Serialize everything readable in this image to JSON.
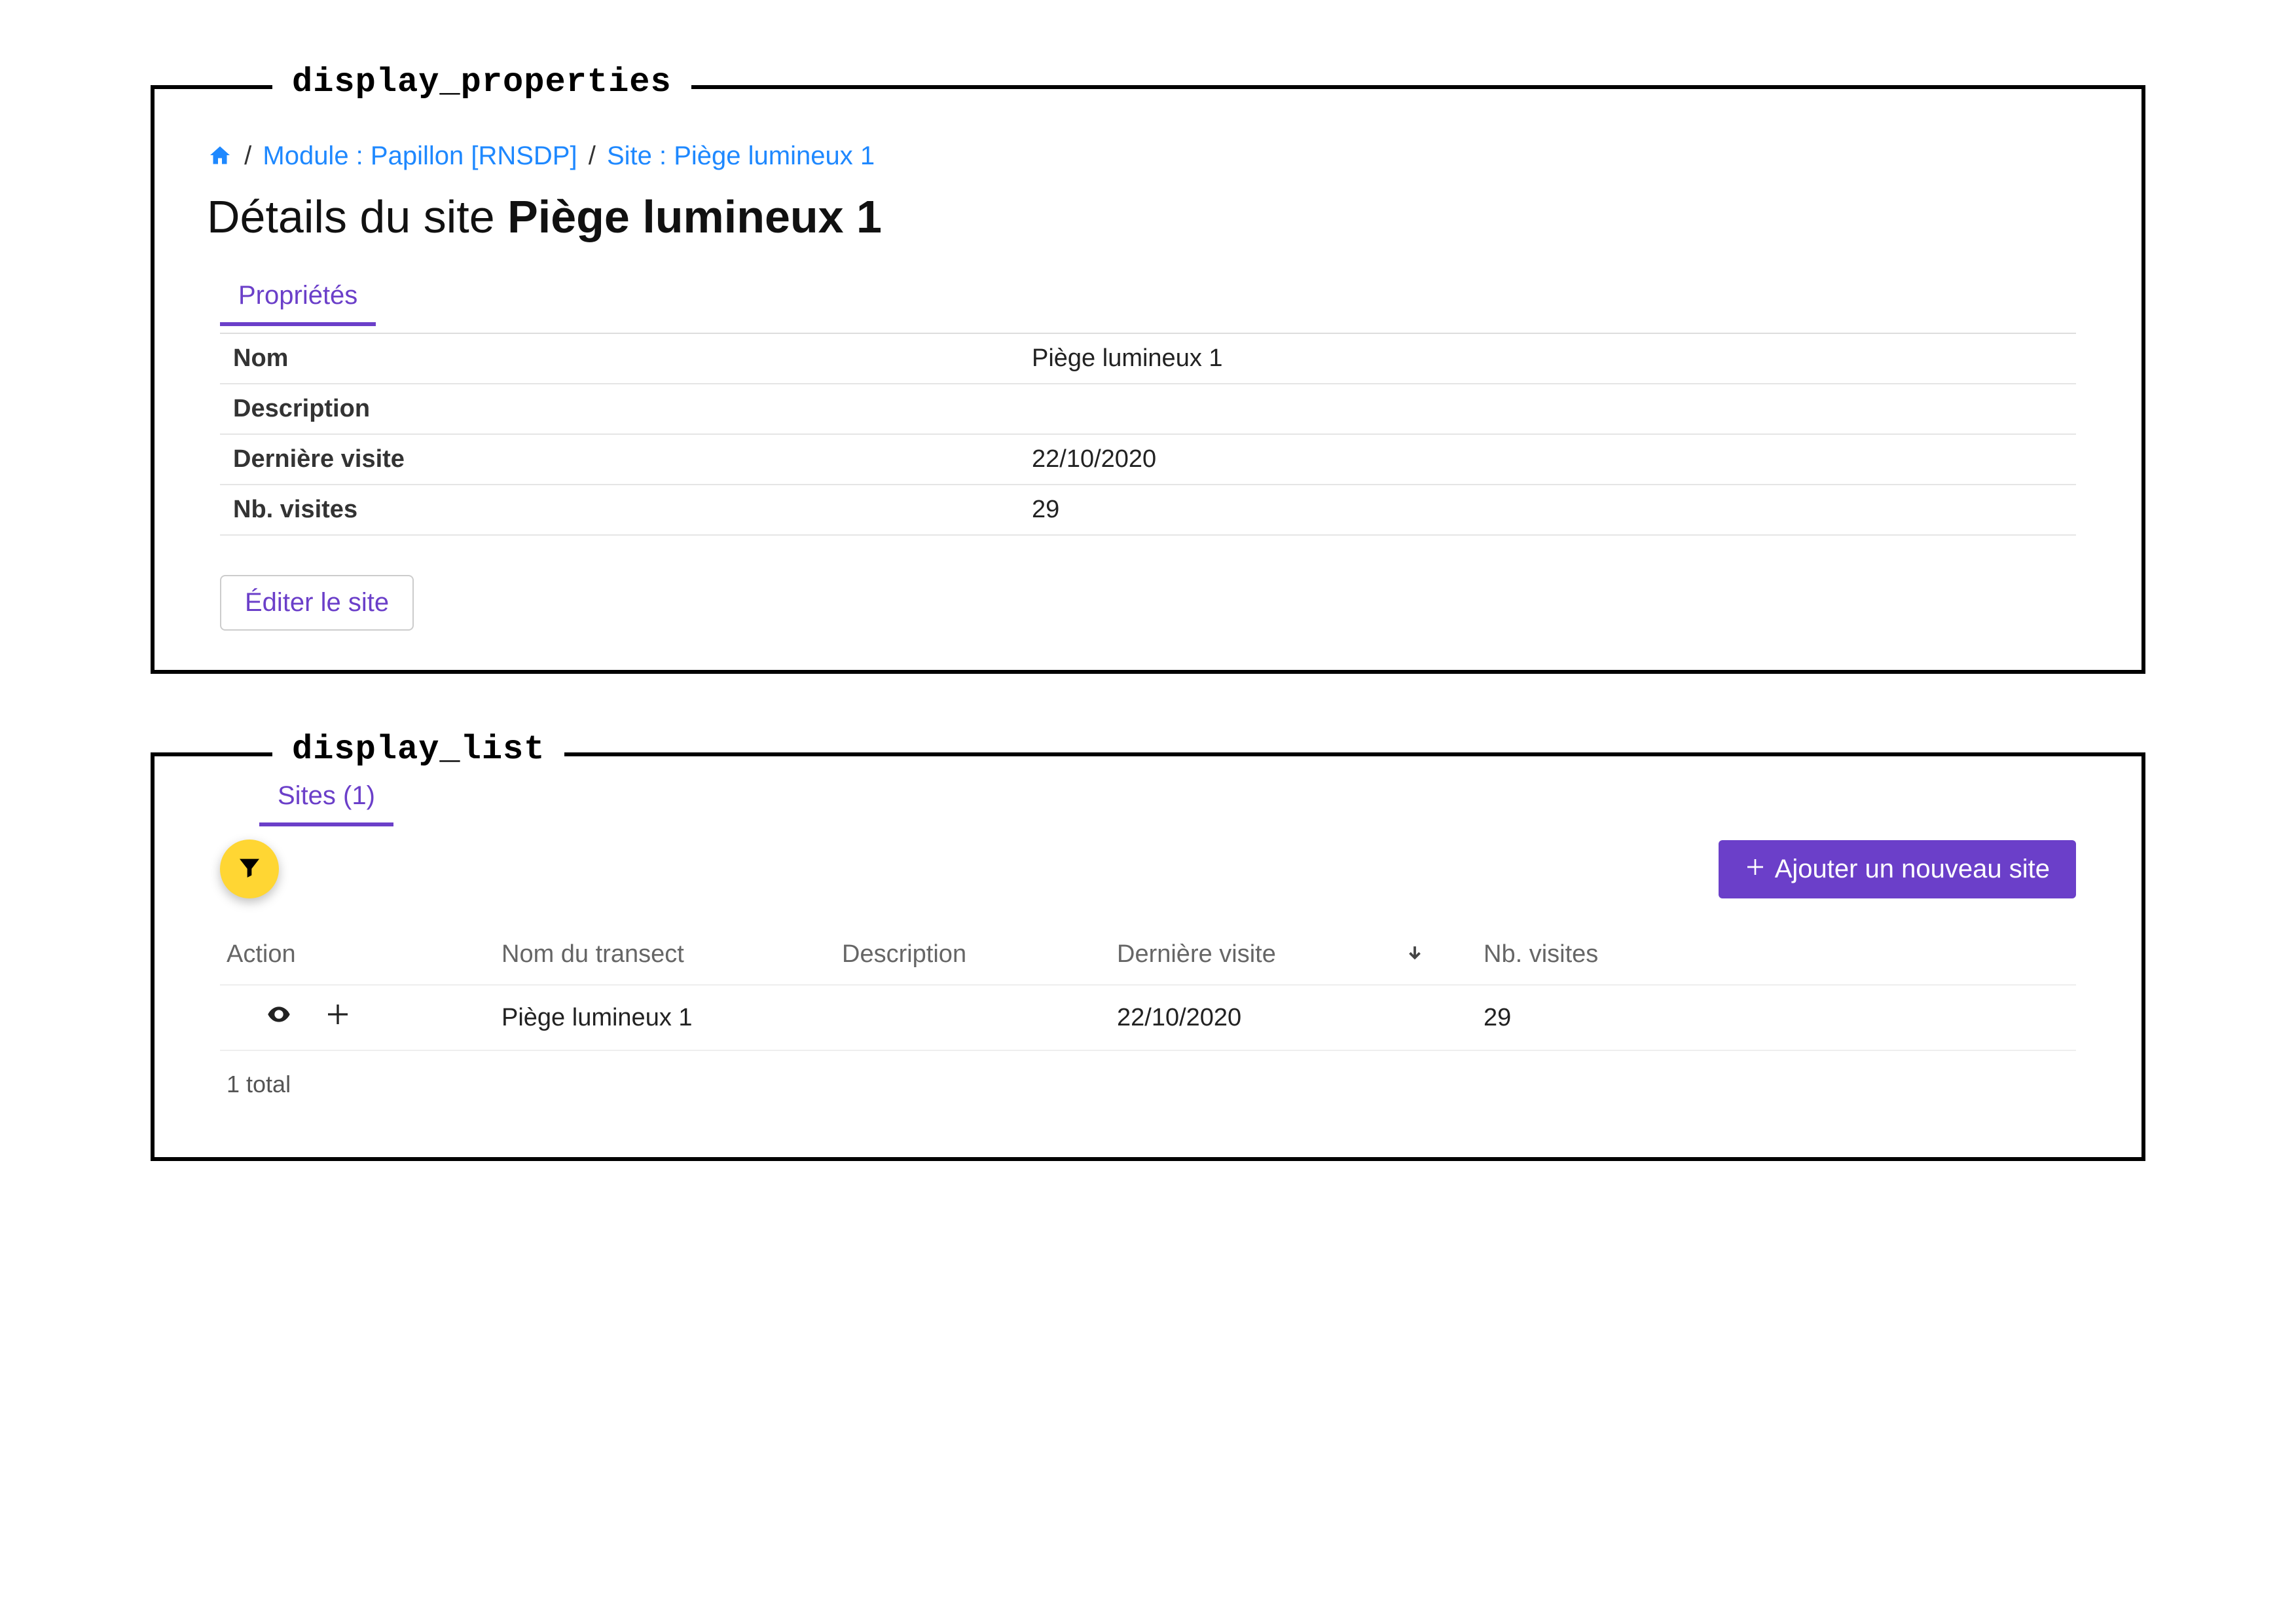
{
  "labels": {
    "display_properties": "display_properties",
    "display_list": "display_list"
  },
  "breadcrumb": {
    "module": "Module : Papillon [RNSDP]",
    "site": "Site : Piège lumineux 1",
    "sep": "/"
  },
  "page": {
    "title_prefix": "Détails du site ",
    "title_main": "Piège lumineux 1"
  },
  "tabs": {
    "properties": "Propriétés",
    "sites": "Sites (1)"
  },
  "properties": {
    "rows": [
      {
        "label": "Nom",
        "value": "Piège lumineux 1"
      },
      {
        "label": "Description",
        "value": ""
      },
      {
        "label": "Dernière visite",
        "value": "22/10/2020"
      },
      {
        "label": "Nb. visites",
        "value": "29"
      }
    ],
    "edit_button": "Éditer le site"
  },
  "list": {
    "add_button": "Ajouter un nouveau site",
    "columns": {
      "action": "Action",
      "name": "Nom du transect",
      "description": "Description",
      "last_visit": "Dernière visite",
      "nb_visits": "Nb. visites"
    },
    "rows": [
      {
        "name": "Piège lumineux 1",
        "description": "",
        "last_visit": "22/10/2020",
        "nb_visits": "29"
      }
    ],
    "footer": "1 total"
  }
}
